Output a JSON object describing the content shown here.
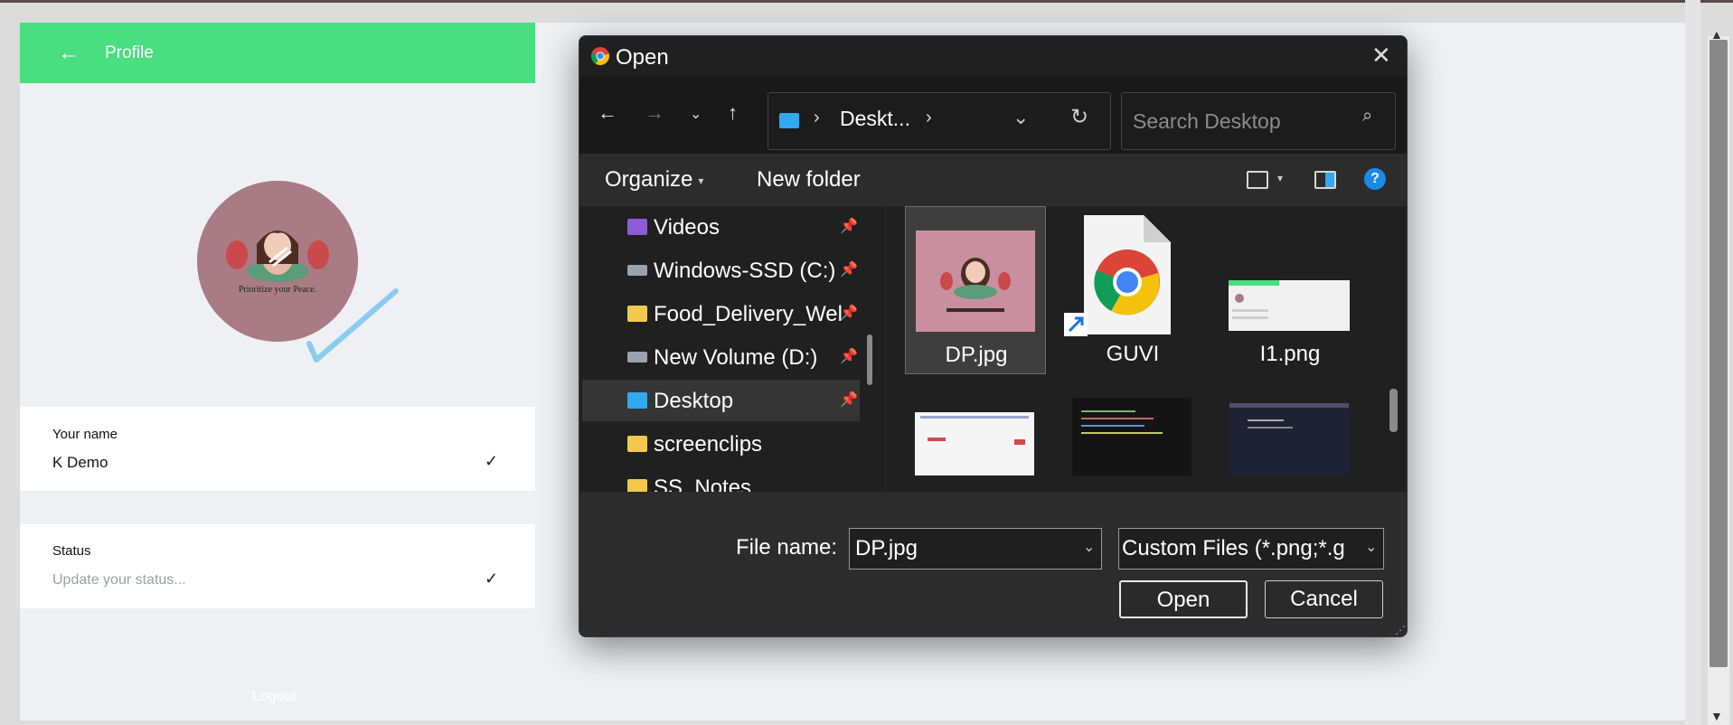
{
  "profile": {
    "title": "Profile",
    "avatar_caption": "Prioritize your Peace.",
    "name_label": "Your name",
    "name_value": "K Demo",
    "status_label": "Status",
    "status_placeholder": "Update your status...",
    "logout_label": "Logout",
    "accent": "#49de7f"
  },
  "dialog": {
    "title": "Open",
    "address_folder": "Deskt...",
    "search_placeholder": "Search Desktop",
    "toolbar": {
      "organize": "Organize",
      "new_folder": "New folder",
      "help": "?"
    },
    "nav_items": [
      {
        "label": "Videos",
        "icon": "videos-folder-icon",
        "pinned": true
      },
      {
        "label": "Windows-SSD (C:)",
        "icon": "drive-icon",
        "pinned": true
      },
      {
        "label": "Food_Delivery_Wel",
        "icon": "folder-icon",
        "pinned": true
      },
      {
        "label": "New Volume (D:)",
        "icon": "drive-icon",
        "pinned": true
      },
      {
        "label": "Desktop",
        "icon": "desktop-folder-icon",
        "pinned": true,
        "selected": true
      },
      {
        "label": "screenclips",
        "icon": "folder-icon",
        "pinned": false
      },
      {
        "label": "SS_Notes",
        "icon": "folder-icon",
        "pinned": false
      }
    ],
    "files": [
      {
        "name": "DP.jpg",
        "selected": true
      },
      {
        "name": "GUVI",
        "selected": false
      },
      {
        "name": "I1.png",
        "selected": false
      }
    ],
    "file_name_label": "File name:",
    "file_name_value": "DP.jpg",
    "file_type_value": "Custom Files (*.png;*.g",
    "open_button": "Open",
    "cancel_button": "Cancel"
  }
}
